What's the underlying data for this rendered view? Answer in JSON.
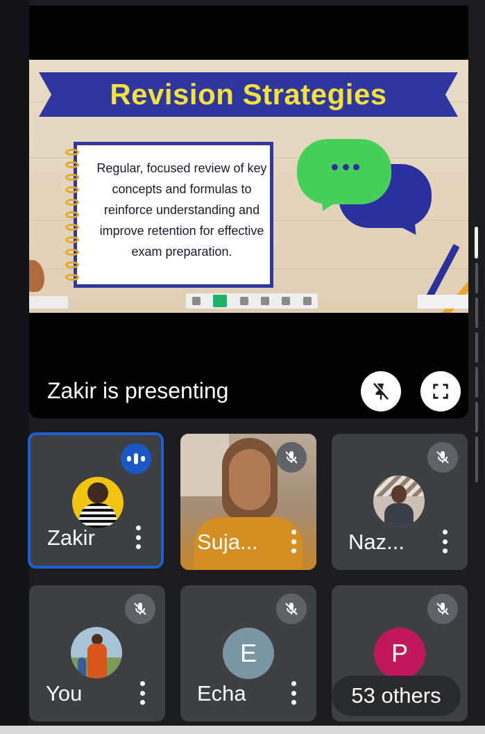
{
  "presentation": {
    "slide": {
      "title": "Revision Strategies",
      "body": "Regular, focused review of key concepts and formulas to reinforce understanding and improve retention for effective exam preparation."
    },
    "presenting_label": "Zakir is presenting",
    "pin_icon": "unpin-icon",
    "fullscreen_icon": "fullscreen-icon"
  },
  "participants": [
    {
      "name": "Zakir",
      "state": "speaking"
    },
    {
      "name": "Suja...",
      "state": "muted"
    },
    {
      "name": "Naz...",
      "state": "muted"
    },
    {
      "name": "You",
      "state": "muted"
    },
    {
      "name": "Echa",
      "state": "muted",
      "initial": "E",
      "avatar_color": "#7b96a3"
    },
    {
      "initial": "P",
      "state": "muted",
      "avatar_color": "#c2185b"
    }
  ],
  "others_label": "53 others",
  "colors": {
    "speaking_border": "#1f5fd6",
    "tile_bg": "#3c4043"
  }
}
